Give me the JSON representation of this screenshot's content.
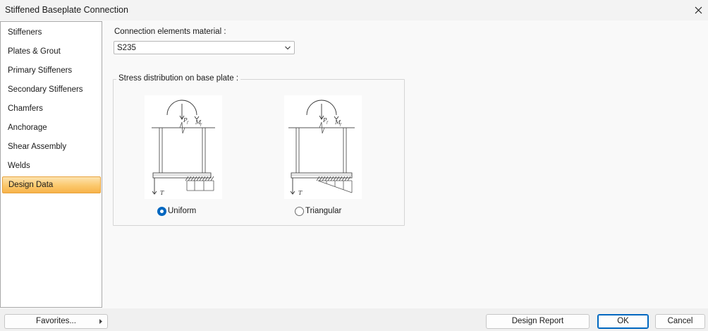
{
  "window": {
    "title": "Stiffened Baseplate Connection"
  },
  "sidebar": {
    "items": [
      {
        "label": "Stiffeners"
      },
      {
        "label": "Plates & Grout"
      },
      {
        "label": "Primary Stiffeners"
      },
      {
        "label": "Secondary Stiffeners"
      },
      {
        "label": "Chamfers"
      },
      {
        "label": "Anchorage"
      },
      {
        "label": "Shear Assembly"
      },
      {
        "label": "Welds"
      },
      {
        "label": "Design Data",
        "selected": true
      }
    ]
  },
  "main": {
    "material_label": "Connection elements material :",
    "material_value": "S235",
    "stress_group_label": "Stress distribution on base plate :",
    "options": [
      {
        "label": "Uniform",
        "selected": true
      },
      {
        "label": "Triangular",
        "selected": false
      }
    ],
    "diagram_labels": {
      "load": "P",
      "load_sub": "f",
      "moment": "M",
      "moment_sub": "f",
      "tension": "T"
    }
  },
  "footer": {
    "favorites_label": "Favorites...",
    "design_report_label": "Design Report",
    "ok_label": "OK",
    "cancel_label": "Cancel"
  },
  "colors": {
    "accent": "#0067c0",
    "selected_item": "#fbc86c"
  }
}
